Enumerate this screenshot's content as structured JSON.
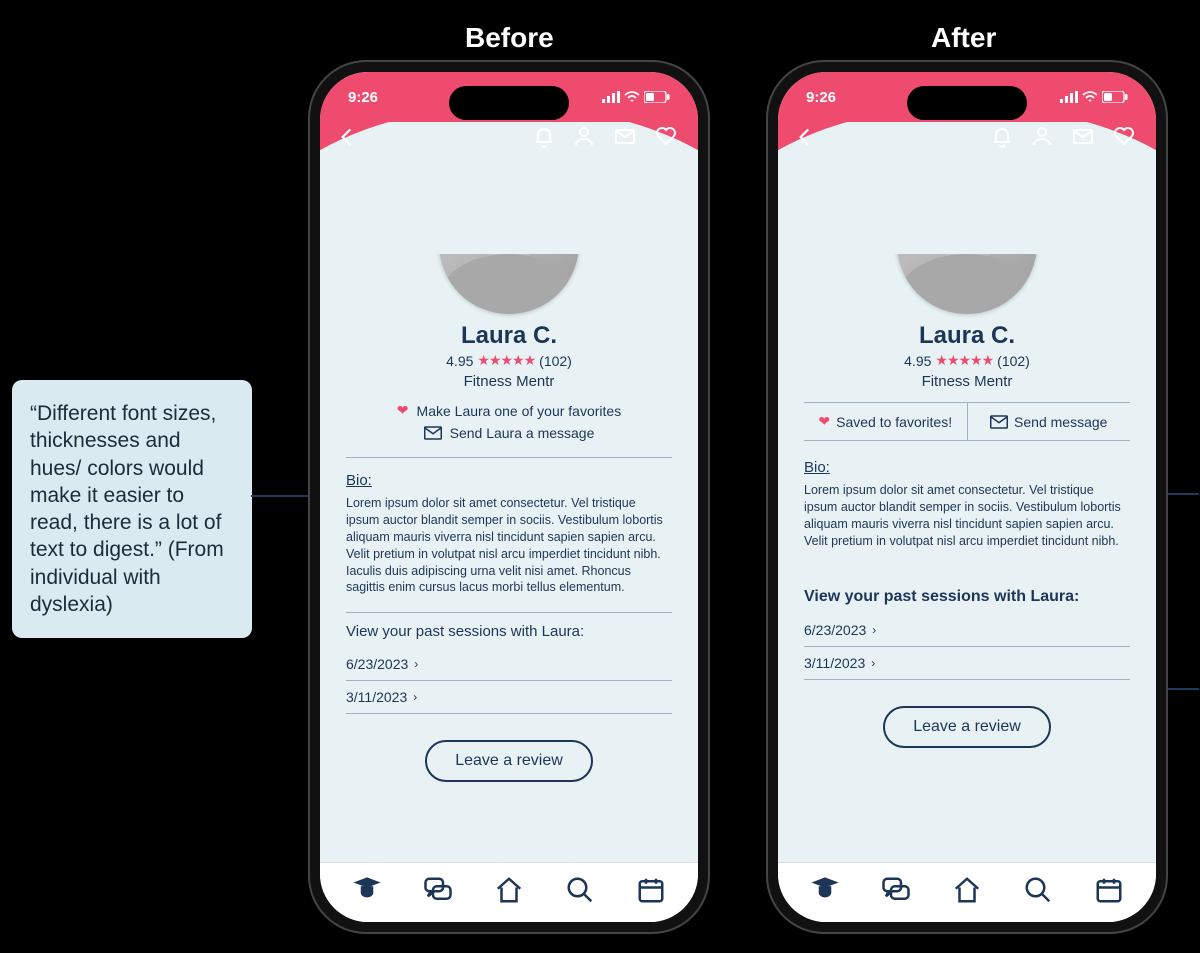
{
  "metadata": {
    "labels": {
      "before": "Before",
      "after": "After"
    }
  },
  "quote": {
    "text": "“Different font sizes, thicknesses and hues/ colors would make it easier to read, there is a lot of text to digest.” (From individual with dyslexia)"
  },
  "status": {
    "time": "9:26"
  },
  "profile": {
    "name": "Laura C.",
    "rating_value": "4.95",
    "rating_count": "(102)",
    "role": "Fitness Mentr"
  },
  "before": {
    "favorite_label": "Make Laura one of your favorites",
    "message_label": "Send Laura a message",
    "bio_label": "Bio:",
    "bio_text": "Lorem ipsum dolor sit amet consectetur. Vel tristique ipsum auctor blandit semper in sociis. Vestibulum lobortis aliquam mauris viverra nisl tincidunt sapien sapien arcu. Velit pretium in volutpat nisl arcu imperdiet tincidunt nibh. Iaculis duis adipiscing urna velit nisi amet. Rhoncus sagittis enim cursus lacus morbi tellus elementum.",
    "sessions_title": "View your past sessions with Laura:",
    "sessions": [
      "6/23/2023",
      "3/11/2023"
    ],
    "review_button": "Leave a review"
  },
  "after": {
    "favorite_label": "Saved to favorites!",
    "message_label": "Send message",
    "bio_label": "Bio:",
    "bio_text": "Lorem ipsum dolor sit amet consectetur. Vel tristique ipsum auctor blandit semper in sociis. Vestibulum lobortis aliquam mauris viverra nisl tincidunt sapien sapien arcu. Velit pretium in volutpat nisl arcu imperdiet tincidunt nibh.",
    "sessions_title": "View your past sessions with Laura:",
    "sessions": [
      "6/23/2023",
      "3/11/2023"
    ],
    "review_button": "Leave a review"
  },
  "colors": {
    "accent": "#ef4b6e",
    "text": "#1d3557",
    "bg": "#e8f2f5"
  }
}
